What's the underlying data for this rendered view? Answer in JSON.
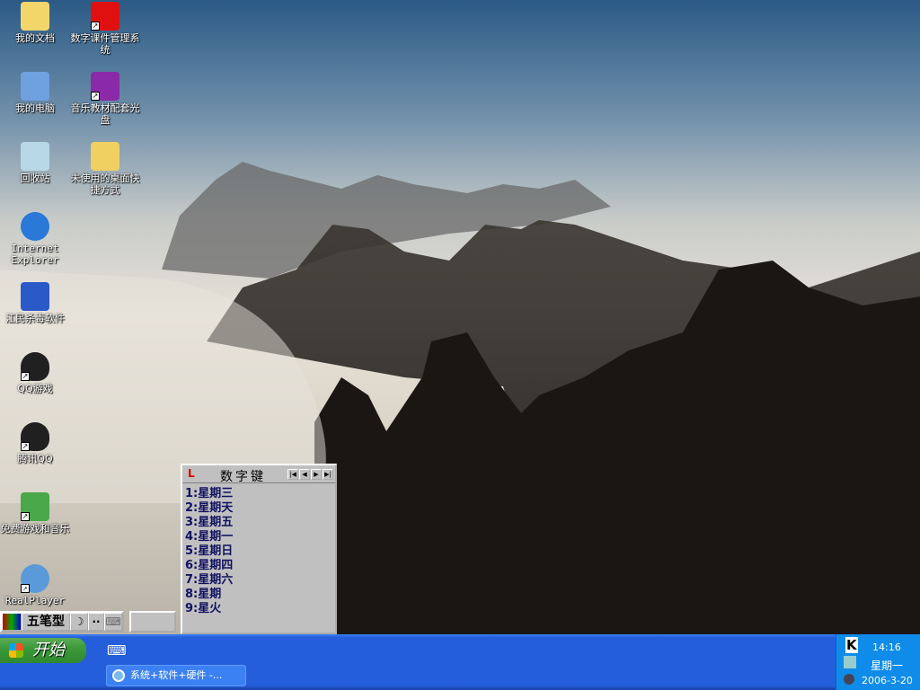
{
  "desktop_icons": [
    {
      "label": "我的文档",
      "icon": "my-documents-icon"
    },
    {
      "label": "数字课件管理系统",
      "icon": "courseware-app-icon"
    },
    {
      "label": "我的电脑",
      "icon": "my-computer-icon"
    },
    {
      "label": "音乐教材配套光盘",
      "icon": "music-cd-icon"
    },
    {
      "label": "回收站",
      "icon": "recycle-bin-icon"
    },
    {
      "label": "未使用的桌面快捷方式",
      "icon": "folder-icon"
    },
    {
      "label": "Internet Explorer",
      "icon": "ie-icon"
    },
    {
      "label": "江民杀毒软件",
      "icon": "antivirus-icon"
    },
    {
      "label": "QQ游戏",
      "icon": "qq-game-icon"
    },
    {
      "label": "腾讯QQ",
      "icon": "qq-icon"
    },
    {
      "label": "免费游戏和音乐",
      "icon": "gift-icon"
    },
    {
      "label": "RealPlayer",
      "icon": "realplayer-icon"
    }
  ],
  "candidate": {
    "title": "数字键",
    "items": [
      "1:星期三",
      "2:星期天",
      "3:星期五",
      "4:星期一",
      "5:星期日",
      "6:星期四",
      "7:星期六",
      "8:星期",
      "9:星火"
    ]
  },
  "ime": {
    "mode": "五笔型",
    "moon": "☽",
    "punct": "··"
  },
  "taskbar": {
    "start": "开始",
    "task": "系统+软件+硬件 -..."
  },
  "tray": {
    "time": "14:16",
    "weekday": "星期一",
    "date": "2006-3-20",
    "k": "K"
  }
}
